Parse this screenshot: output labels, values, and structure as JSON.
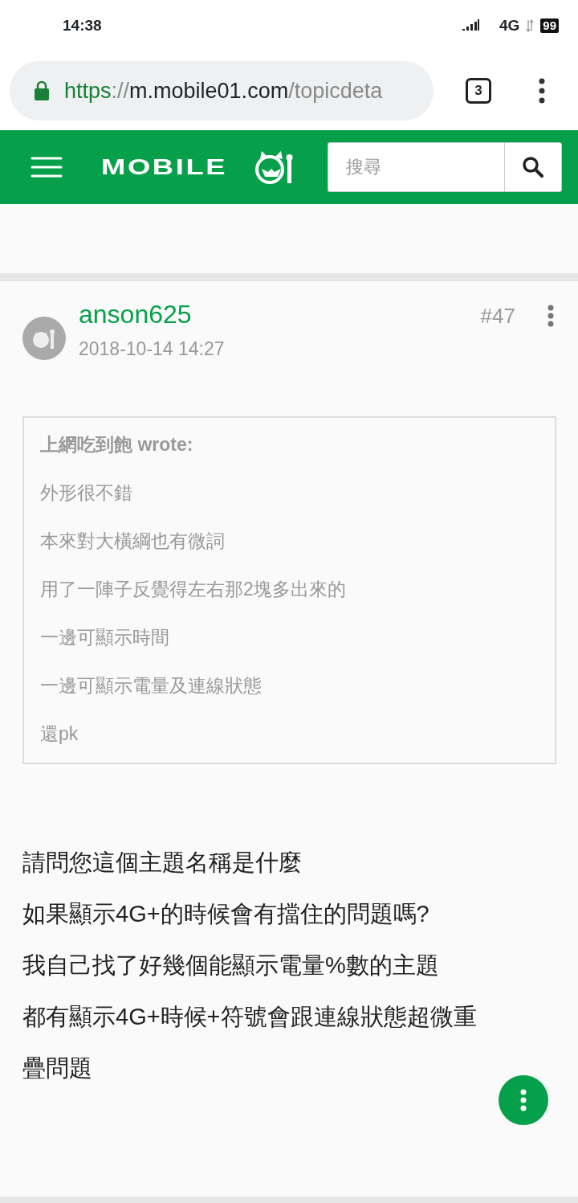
{
  "status_bar": {
    "time": "14:38",
    "network": "4G",
    "battery": "99"
  },
  "browser": {
    "url": {
      "scheme": "https",
      "separator": "://",
      "host": "m.mobile01.com",
      "path": "/topicdeta"
    },
    "tab_count": "3"
  },
  "header": {
    "logo": "MOBILE",
    "search": {
      "placeholder": "搜尋"
    }
  },
  "post": {
    "author": "anson625",
    "date": "2018-10-14 14:27",
    "number": "#47",
    "quote": {
      "author": "上網吃到飽",
      "verb": "wrote:",
      "lines": [
        "外形很不錯",
        "本來對大橫綱也有微詞",
        "用了一陣子反覺得左右那2塊多出來的",
        "一邊可顯示時間",
        "一邊可顯示電量及連線狀態",
        "還pk"
      ]
    },
    "body": [
      "請問您這個主題名稱是什麼",
      "如果顯示4G+的時候會有擋住的問題嗎?",
      "我自己找了好幾個能顯示電量%數的主題",
      "都有顯示4G+時候+符號會跟連線狀態超微重疊問題"
    ]
  }
}
